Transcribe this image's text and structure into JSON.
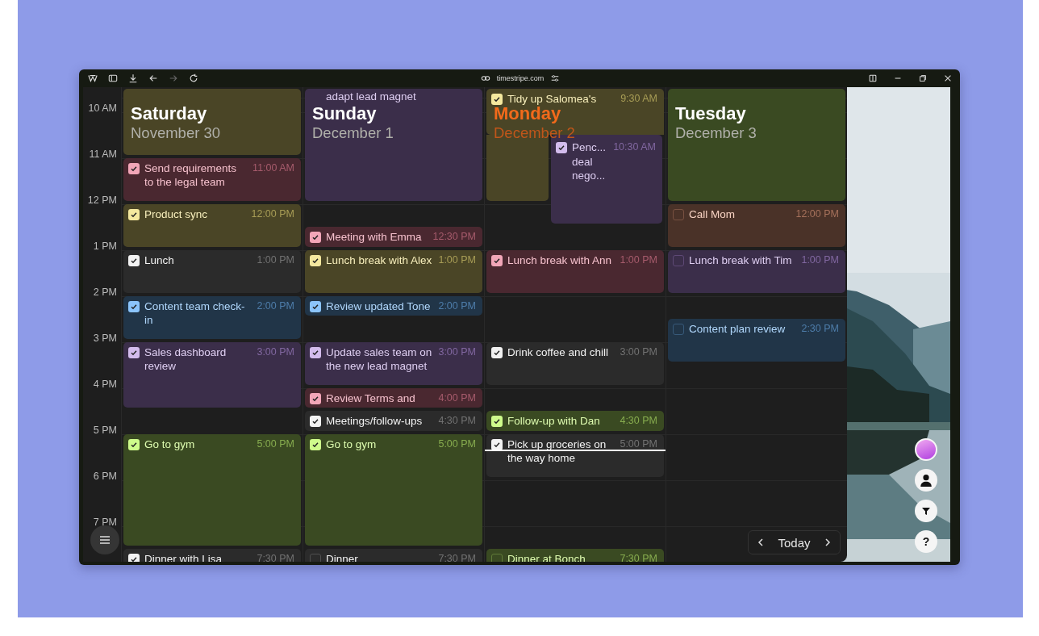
{
  "browser": {
    "url": "timestripe.com"
  },
  "time_labels": [
    "10 AM",
    "11 AM",
    "12 PM",
    "1 PM",
    "2 PM",
    "3 PM",
    "4 PM",
    "5 PM",
    "6 PM",
    "7 PM"
  ],
  "days": [
    {
      "weekday": "Saturday",
      "date": "November 30",
      "today": false,
      "events": [
        {
          "kind": "blank",
          "color": "#4a4526"
        },
        {
          "kind": "task",
          "title": "Send requirements to the legal team",
          "time": "11:00 AM",
          "color": "#4a2830",
          "checked": true
        },
        {
          "kind": "task",
          "title": "Product sync",
          "time": "12:00 PM",
          "color": "#4a4526",
          "checked": true
        },
        {
          "kind": "task",
          "title": "Lunch",
          "time": "1:00 PM",
          "color": "#2b2b2b",
          "checked": true
        },
        {
          "kind": "task",
          "title": "Content team check-in",
          "time": "2:00 PM",
          "color": "#213548",
          "checked": true
        },
        {
          "kind": "task",
          "title": "Sales dashboard review",
          "time": "3:00 PM",
          "color": "#3b2e4a",
          "checked": true
        },
        {
          "kind": "task",
          "title": "Go to gym",
          "time": "5:00 PM",
          "color": "#3a4a22",
          "checked": true
        },
        {
          "kind": "task",
          "title": "Dinner with Lisa",
          "time": "7:30 PM",
          "color": "#2b2b2b",
          "checked": true
        }
      ]
    },
    {
      "weekday": "Sunday",
      "date": "December 1",
      "today": false,
      "events": [
        {
          "kind": "continued",
          "title": "adapt lead magnet",
          "color": "#3b2e4a"
        },
        {
          "kind": "task",
          "title": "Meeting with Emma",
          "time": "12:30 PM",
          "color": "#4a2830",
          "checked": true
        },
        {
          "kind": "task",
          "title": "Lunch break with Alex",
          "time": "1:00 PM",
          "color": "#4a4526",
          "checked": true
        },
        {
          "kind": "task",
          "title": "Review updated Tone",
          "time": "2:00 PM",
          "color": "#213548",
          "checked": true
        },
        {
          "kind": "task",
          "title": "Update sales team on the new lead magnet",
          "time": "3:00 PM",
          "color": "#3b2e4a",
          "checked": true
        },
        {
          "kind": "task",
          "title": "Review Terms and",
          "time": "4:00 PM",
          "color": "#4a2830",
          "checked": true
        },
        {
          "kind": "task",
          "title": "Meetings/follow-ups",
          "time": "4:30 PM",
          "color": "#2b2b2b",
          "checked": true
        },
        {
          "kind": "task",
          "title": "Go to gym",
          "time": "5:00 PM",
          "color": "#3a4a22",
          "checked": true
        },
        {
          "kind": "task",
          "title": "Dinner",
          "time": "7:30 PM",
          "color": "#2b2b2b",
          "checked": false
        }
      ]
    },
    {
      "weekday": "Monday",
      "date": "December 2",
      "today": true,
      "events": [
        {
          "kind": "task",
          "title": "Tidy up Salomea's",
          "time": "9:30 AM",
          "color": "#4a4526",
          "checked": true
        },
        {
          "kind": "task",
          "title": "Penc... deal nego...",
          "time": "10:30 AM",
          "color": "#3b2e4a",
          "checked": true
        },
        {
          "kind": "task",
          "title": "Lunch break with Ann",
          "time": "1:00 PM",
          "color": "#4a2830",
          "checked": true
        },
        {
          "kind": "task",
          "title": "Drink coffee and chill",
          "time": "3:00 PM",
          "color": "#2b2b2b",
          "checked": true
        },
        {
          "kind": "task",
          "title": "Follow-up with Dan",
          "time": "4:30 PM",
          "color": "#3a4a22",
          "checked": true
        },
        {
          "kind": "task",
          "title": "Pick up groceries on the way home",
          "time": "5:00 PM",
          "color": "#2b2b2b",
          "checked": true
        },
        {
          "kind": "task",
          "title": "Dinner at Bonch",
          "time": "7:30 PM",
          "color": "#3a4a22",
          "checked": false
        }
      ]
    },
    {
      "weekday": "Tuesday",
      "date": "December 3",
      "today": false,
      "events": [
        {
          "kind": "blank",
          "color": "#3a4a22"
        },
        {
          "kind": "task",
          "title": "Call Mom",
          "time": "12:00 PM",
          "color": "#4a3228",
          "checked": false
        },
        {
          "kind": "task",
          "title": "Lunch break with Tim",
          "time": "1:00 PM",
          "color": "#3b2e4a",
          "checked": false
        },
        {
          "kind": "task",
          "title": "Content plan review",
          "time": "2:30 PM",
          "color": "#213548",
          "checked": false
        }
      ]
    }
  ],
  "nav": {
    "label": "Today"
  },
  "help": {
    "label": "?"
  }
}
